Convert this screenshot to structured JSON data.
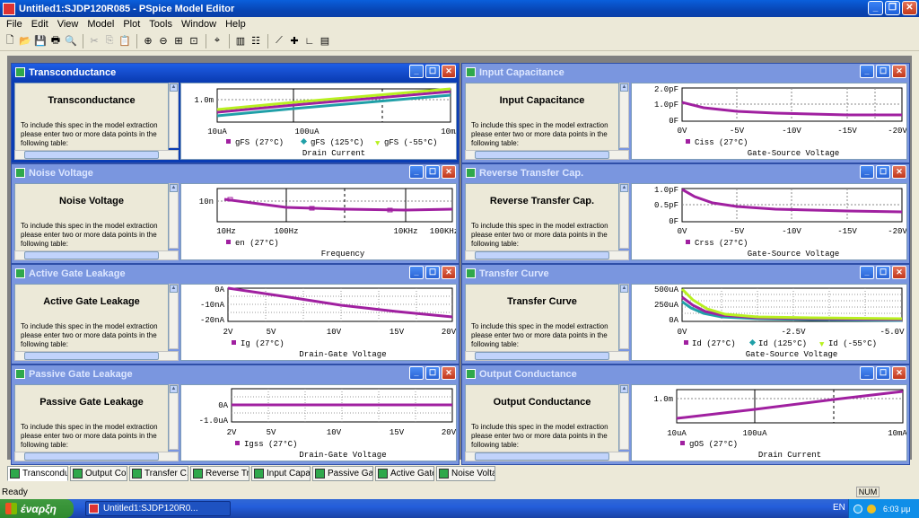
{
  "app": {
    "title": "Untitled1:SJDP120R085 - PSpice Model Editor"
  },
  "menu": [
    "File",
    "Edit",
    "View",
    "Model",
    "Plot",
    "Tools",
    "Window",
    "Help"
  ],
  "toolbar": {
    "icons": [
      "new-icon",
      "open-icon",
      "save-icon",
      "print-icon",
      "print-preview-icon",
      "cut-icon",
      "copy-icon",
      "paste-icon",
      "zoom-in-icon",
      "zoom-out-icon",
      "zoom-area-icon",
      "zoom-fit-icon",
      "cursor-icon",
      "grid-icon",
      "table-icon",
      "extract-icon",
      "add-point-icon",
      "log-axis-icon",
      "plot-options-icon"
    ]
  },
  "panel_text": "To include this spec in the model extraction please enter two or more data points in the following table:",
  "colors": {
    "magenta": "#a020a0",
    "teal": "#20a0a8",
    "yellowgreen": "#b8f020",
    "active_title": "#0b3db4",
    "inactive_title": "#7a96df"
  },
  "windows": [
    {
      "id": "transconductance",
      "title": "Transconductance",
      "heading": "Transconductance",
      "active": true,
      "xtick_labels": [
        "10uA",
        "100uA",
        "10mA"
      ],
      "ytick_labels": [
        "1.0m"
      ],
      "xlabel": "Drain Current",
      "legend": [
        "gFS (27°C)",
        "gFS (125°C)",
        "gFS (-55°C)"
      ]
    },
    {
      "id": "input-capacitance",
      "title": "Input Capacitance",
      "heading": "Input Capacitance",
      "active": false,
      "xtick_labels": [
        "0V",
        "-5V",
        "-10V",
        "-15V",
        "-20V"
      ],
      "ytick_labels": [
        "2.0pF",
        "1.0pF",
        "0F"
      ],
      "xlabel": "Gate-Source Voltage",
      "legend": [
        "Ciss (27°C)"
      ]
    },
    {
      "id": "noise-voltage",
      "title": "Noise Voltage",
      "heading": "Noise Voltage",
      "active": false,
      "xtick_labels": [
        "10Hz",
        "100Hz",
        "10KHz",
        "100KHz"
      ],
      "ytick_labels": [
        "10n"
      ],
      "xlabel": "Frequency",
      "legend": [
        "en (27°C)"
      ]
    },
    {
      "id": "reverse-transfer-cap",
      "title": "Reverse Transfer Cap.",
      "heading": "Reverse Transfer Cap.",
      "active": false,
      "xtick_labels": [
        "0V",
        "-5V",
        "-10V",
        "-15V",
        "-20V"
      ],
      "ytick_labels": [
        "1.0pF",
        "0.5pF",
        "0F"
      ],
      "xlabel": "Gate-Source Voltage",
      "legend": [
        "Crss (27°C)"
      ]
    },
    {
      "id": "active-gate-leakage",
      "title": "Active Gate Leakage",
      "heading": "Active Gate Leakage",
      "active": false,
      "xtick_labels": [
        "2V",
        "5V",
        "10V",
        "15V",
        "20V"
      ],
      "ytick_labels": [
        "0A",
        "-10nA",
        "-20nA"
      ],
      "xlabel": "Drain-Gate Voltage",
      "legend": [
        "Ig (27°C)"
      ]
    },
    {
      "id": "transfer-curve",
      "title": "Transfer Curve",
      "heading": "Transfer Curve",
      "active": false,
      "xtick_labels": [
        "0V",
        "-2.5V",
        "-5.0V"
      ],
      "ytick_labels": [
        "500uA",
        "250uA",
        "0A"
      ],
      "xlabel": "Gate-Source Voltage",
      "legend": [
        "Id (27°C)",
        "Id (125°C)",
        "Id (-55°C)"
      ]
    },
    {
      "id": "passive-gate-leakage",
      "title": "Passive Gate Leakage",
      "heading": "Passive Gate Leakage",
      "active": false,
      "xtick_labels": [
        "2V",
        "5V",
        "10V",
        "15V",
        "20V"
      ],
      "ytick_labels": [
        "0A",
        "-1.0uA"
      ],
      "xlabel": "Drain-Gate Voltage",
      "legend": [
        "Igss (27°C)"
      ]
    },
    {
      "id": "output-conductance",
      "title": "Output Conductance",
      "heading": "Output Conductance",
      "active": false,
      "xtick_labels": [
        "10uA",
        "100uA",
        "10mA"
      ],
      "ytick_labels": [
        "1.0m"
      ],
      "xlabel": "Drain Current",
      "legend": [
        "gOS (27°C)"
      ]
    }
  ],
  "tabs": [
    "Transcondu...",
    "Output Con...",
    "Transfer C...",
    "Reverse Tr...",
    "Input Capac...",
    "Passive Gat...",
    "Active Gate...",
    "Noise Voltage"
  ],
  "status": {
    "text": "Ready",
    "num": "NUM"
  },
  "taskbar": {
    "start": "έναρξη",
    "item": "Untitled1:SJDP120R0...",
    "lang": "EN",
    "clock": "6:03 μμ"
  },
  "chart_data": [
    {
      "type": "line",
      "title": "Transconductance",
      "xlabel": "Drain Current",
      "x": [
        "10uA",
        "100uA",
        "10mA"
      ],
      "series": [
        {
          "name": "gFS (27°C)",
          "values": [
            "0.88m",
            "1.0m",
            "1.13m"
          ]
        },
        {
          "name": "gFS (125°C)",
          "values": [
            "0.83m",
            "0.96m",
            "1.08m"
          ]
        },
        {
          "name": "gFS (-55°C)",
          "values": [
            "0.92m",
            "1.05m",
            "1.18m"
          ]
        }
      ]
    },
    {
      "type": "line",
      "title": "Input Capacitance",
      "xlabel": "Gate-Source Voltage",
      "x": [
        "0V",
        "-5V",
        "-10V",
        "-15V",
        "-20V"
      ],
      "series": [
        {
          "name": "Ciss (27°C)",
          "values": [
            "1.15pF",
            "0.7pF",
            "0.55pF",
            "0.5pF",
            "0.48pF"
          ]
        }
      ]
    },
    {
      "type": "line",
      "title": "Noise Voltage",
      "xlabel": "Frequency",
      "x": [
        "10Hz",
        "100Hz",
        "10KHz",
        "100KHz"
      ],
      "series": [
        {
          "name": "en (27°C)",
          "values": [
            "10n",
            "8n",
            "7.5n",
            "7.5n"
          ]
        }
      ]
    },
    {
      "type": "line",
      "title": "Reverse Transfer Cap.",
      "xlabel": "Gate-Source Voltage",
      "x": [
        "0V",
        "-5V",
        "-10V",
        "-15V",
        "-20V"
      ],
      "series": [
        {
          "name": "Crss (27°C)",
          "values": [
            "1.0pF",
            "0.35pF",
            "0.25pF",
            "0.22pF",
            "0.2pF"
          ]
        }
      ]
    },
    {
      "type": "line",
      "title": "Active Gate Leakage",
      "xlabel": "Drain-Gate Voltage",
      "x": [
        "2V",
        "5V",
        "10V",
        "15V",
        "20V"
      ],
      "series": [
        {
          "name": "Ig (27°C)",
          "values": [
            "0A",
            "-3nA",
            "-9nA",
            "-14nA",
            "-19nA"
          ]
        }
      ]
    },
    {
      "type": "line",
      "title": "Transfer Curve",
      "xlabel": "Gate-Source Voltage",
      "x": [
        "0V",
        "-2.5V",
        "-5.0V"
      ],
      "series": [
        {
          "name": "Id (27°C)",
          "values": [
            "330uA",
            "5uA",
            "0A"
          ]
        },
        {
          "name": "Id (125°C)",
          "values": [
            "280uA",
            "8uA",
            "0A"
          ]
        },
        {
          "name": "Id (-55°C)",
          "values": [
            "480uA",
            "10uA",
            "0A"
          ]
        }
      ]
    },
    {
      "type": "line",
      "title": "Passive Gate Leakage",
      "xlabel": "Drain-Gate Voltage",
      "x": [
        "2V",
        "5V",
        "10V",
        "15V",
        "20V"
      ],
      "series": [
        {
          "name": "Igss (27°C)",
          "values": [
            "0A",
            "0A",
            "0A",
            "0A",
            "0A"
          ]
        }
      ]
    },
    {
      "type": "line",
      "title": "Output Conductance",
      "xlabel": "Drain Current",
      "x": [
        "10uA",
        "100uA",
        "10mA"
      ],
      "series": [
        {
          "name": "gOS (27°C)",
          "values": [
            "0.4m",
            "0.7m",
            "1.3m"
          ]
        }
      ]
    }
  ]
}
